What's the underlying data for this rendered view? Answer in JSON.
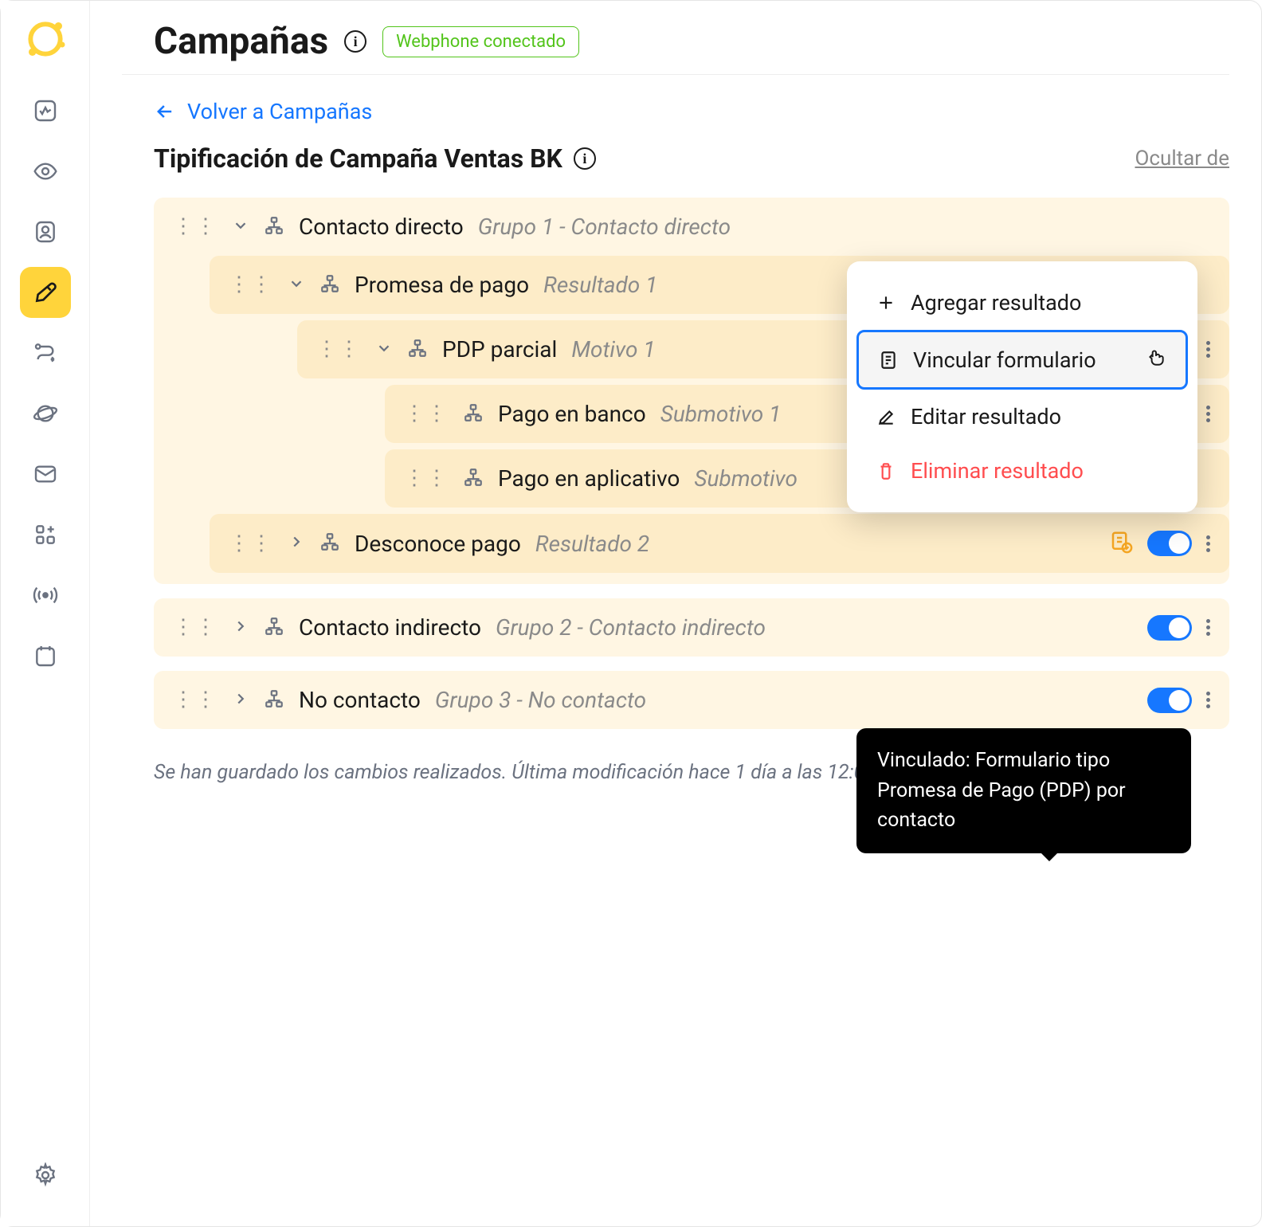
{
  "header": {
    "title": "Campañas",
    "status": "Webphone conectado"
  },
  "back_link": "Volver a Campañas",
  "subheader": {
    "title": "Tipificación de Campaña Ventas BK",
    "hide_link": "Ocultar de"
  },
  "context_menu": {
    "add": "Agregar resultado",
    "link": "Vincular formulario",
    "edit": "Editar resultado",
    "delete": "Eliminar resultado"
  },
  "tooltip": "Vinculado: Formulario tipo Promesa de Pago (PDP) por contacto",
  "groups": [
    {
      "label": "Contacto directo",
      "sublabel": "Grupo 1 - Contacto directo",
      "expanded": true,
      "results": [
        {
          "label": "Promesa de pago",
          "sublabel": "Resultado 1",
          "expanded": true,
          "motives": [
            {
              "label": "PDP parcial",
              "sublabel": "Motivo 1",
              "expanded": true,
              "submotives": [
                {
                  "label": "Pago en banco",
                  "sublabel": "Submotivo 1"
                },
                {
                  "label": "Pago en aplicativo",
                  "sublabel": "Submotivo"
                }
              ]
            }
          ]
        },
        {
          "label": "Desconoce pago",
          "sublabel": "Resultado 2",
          "expanded": false,
          "form_linked": true
        }
      ]
    },
    {
      "label": "Contacto indirecto",
      "sublabel": "Grupo 2 - Contacto indirecto",
      "expanded": false
    },
    {
      "label": "No contacto",
      "sublabel": "Grupo 3 - No contacto",
      "expanded": false
    }
  ],
  "footer": "Se han guardado los cambios realizados. Última modificación hace 1 día a las 12:02:00"
}
